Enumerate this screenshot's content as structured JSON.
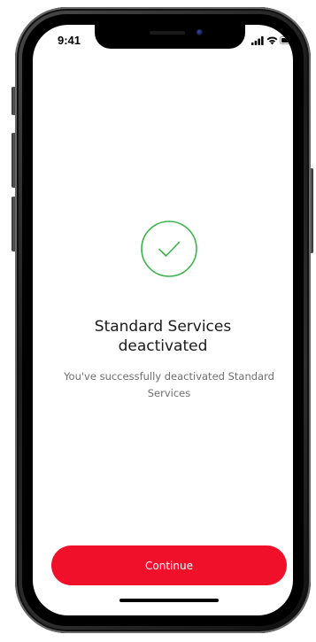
{
  "status_bar": {
    "time": "9:41"
  },
  "confirmation": {
    "icon": "check-circle-icon",
    "title_line1": "Standard Services",
    "title_line2": "deactivated",
    "message_line1": "You've successfully deactivated Standard",
    "message_line2": "Services"
  },
  "actions": {
    "continue_label": "Continue"
  },
  "colors": {
    "accent_red": "#f0102a",
    "success_green": "#3bb54a",
    "title_text": "#1a1a1a",
    "body_text": "#6e6e6e"
  }
}
